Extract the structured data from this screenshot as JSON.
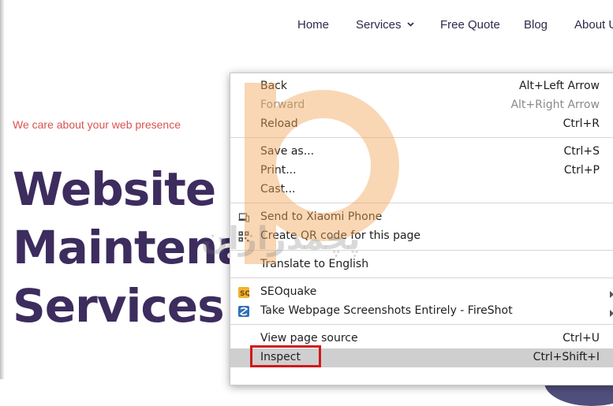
{
  "nav": {
    "items": [
      {
        "label": "Home"
      },
      {
        "label": "Services"
      },
      {
        "label": "Free Quote"
      },
      {
        "label": "Blog"
      },
      {
        "label": "About U"
      }
    ]
  },
  "hero": {
    "tagline": "We care about your web presence",
    "title_lines": [
      "Website",
      "Maintenar",
      "Services"
    ]
  },
  "context_menu": {
    "items": [
      {
        "label": "Back",
        "shortcut": "Alt+Left Arrow"
      },
      {
        "label": "Forward",
        "shortcut": "Alt+Right Arrow",
        "disabled": true
      },
      {
        "label": "Reload",
        "shortcut": "Ctrl+R"
      },
      {
        "label": "Save as...",
        "shortcut": "Ctrl+S"
      },
      {
        "label": "Print...",
        "shortcut": "Ctrl+P"
      },
      {
        "label": "Cast...",
        "shortcut": ""
      },
      {
        "label": "Send to Xiaomi Phone",
        "icon": "device-send-icon"
      },
      {
        "label": "Create QR code for this page",
        "icon": "qr-code-icon"
      },
      {
        "label": "Translate to English",
        "icon": "translate-icon"
      },
      {
        "label": "SEOquake",
        "icon": "seoquake-icon",
        "submenu": true
      },
      {
        "label": "Take Webpage Screenshots Entirely - FireShot",
        "icon": "fireshot-icon",
        "submenu": true
      },
      {
        "label": "View page source",
        "shortcut": "Ctrl+U"
      },
      {
        "label": "Inspect",
        "shortcut": "Ctrl+Shift+I",
        "highlighted": true
      }
    ]
  },
  "watermark": {
    "text": "پچمدرازان"
  },
  "colors": {
    "nav_text": "#2c2a4a",
    "tagline": "#d9534f",
    "hero_title": "#3d2c5e",
    "highlight_box": "#d0191b",
    "menu_highlight": "#cfcfcf",
    "watermark_orange": "#f2a65a"
  }
}
